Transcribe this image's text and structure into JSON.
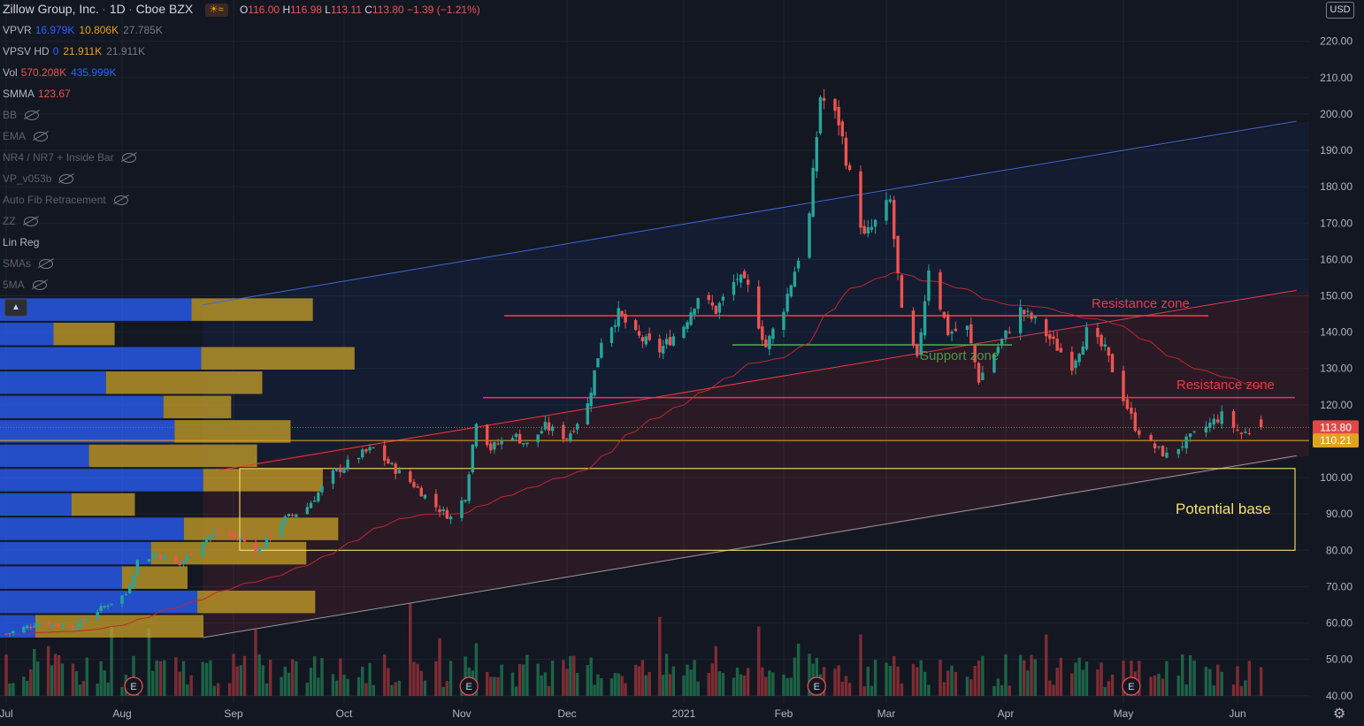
{
  "header": {
    "symbol": "Zillow Group, Inc.",
    "interval": "1D",
    "exchange": "Cboe BZX",
    "ohlc": {
      "o_label": "O",
      "o": "116.00",
      "h_label": "H",
      "h": "116.98",
      "l_label": "L",
      "l": "113.11",
      "c_label": "C",
      "c": "113.80",
      "change": "−1.39 (−1.21%)"
    }
  },
  "indicators": [
    {
      "name": "VPVR",
      "v1": "16.979K",
      "v2": "10.806K",
      "v3": "27.785K",
      "hidden": false
    },
    {
      "name": "VPSV HD",
      "v1": "0",
      "v2": "21.911K",
      "v3": "21.911K",
      "hidden": false
    },
    {
      "name": "Vol",
      "v1": "570.208K",
      "v2": "435.999K",
      "v3": "",
      "hidden": false
    },
    {
      "name": "SMMA",
      "v1": "123.67",
      "v2": "",
      "v3": "",
      "hidden": false
    },
    {
      "name": "BB",
      "hidden": true
    },
    {
      "name": "EMA",
      "hidden": true
    },
    {
      "name": "NR4 / NR7 + Inside Bar",
      "hidden": true
    },
    {
      "name": "VP_v053b",
      "hidden": true
    },
    {
      "name": "Auto Fib Retracement",
      "hidden": true
    },
    {
      "name": "ZZ",
      "hidden": true
    },
    {
      "name": "Lin Reg",
      "hidden": false
    },
    {
      "name": "SMAs",
      "hidden": true
    },
    {
      "name": "5MA",
      "hidden": true
    }
  ],
  "colors": {
    "background": "#131722",
    "up": "#26a69a",
    "down": "#ef5350",
    "volume_up": "#1e6b4a",
    "volume_down": "#8c2f35",
    "vp_blue": "#2962ff",
    "vp_gold": "#c9a227",
    "resistance": "#f23645",
    "support": "#4caf50",
    "channel_upper": "#3f6ad8",
    "channel_lower": "#9598a1",
    "smma": "#c2262e",
    "base_box": "#f5e06b",
    "price_tag": "#e1a21f",
    "last_price": "#e04848"
  },
  "controls": {
    "currency": "USD",
    "collapse_icon": "chevron-up-icon",
    "settings_icon": "gear-icon"
  },
  "annotations": {
    "resistance_1": "Resistance zone",
    "resistance_2": "Resistance zone",
    "support": "Support zone",
    "base": "Potential base"
  },
  "chart_data": {
    "type": "candlestick",
    "title": "",
    "x_ticks": [
      "Jul",
      "Aug",
      "Sep",
      "Oct",
      "Nov",
      "Dec",
      "2021",
      "Feb",
      "Mar",
      "Apr",
      "May",
      "Jun"
    ],
    "x_tick_dates": [
      "2020-07-01",
      "2020-08-03",
      "2020-09-01",
      "2020-10-01",
      "2020-11-02",
      "2020-12-01",
      "2021-01-04",
      "2021-02-01",
      "2021-03-01",
      "2021-04-01",
      "2021-05-03",
      "2021-06-01"
    ],
    "y_ticks": [
      40,
      50,
      60,
      70,
      80,
      90,
      100,
      110,
      120,
      130,
      140,
      150,
      160,
      170,
      180,
      190,
      200,
      210,
      220
    ],
    "ylim": [
      38,
      226
    ],
    "last_price": 113.8,
    "level_price": 110.21,
    "resistance_levels": [
      144.5,
      122
    ],
    "support_level": 136.5,
    "base_zone": [
      80,
      102.5
    ],
    "earnings_markers": [
      "2020-08-06",
      "2020-11-04",
      "2021-02-10",
      "2021-05-05"
    ],
    "earnings_label": "E",
    "channel_upper": [
      {
        "x": "2020-08-24",
        "y": 147.5
      },
      {
        "x": "2021-06-16",
        "y": 198
      }
    ],
    "channel_lower": [
      {
        "x": "2020-08-24",
        "y": 56
      },
      {
        "x": "2021-06-16",
        "y": 106
      }
    ],
    "red_trend": [
      {
        "x": "2020-08-28",
        "y": 102
      },
      {
        "x": "2021-06-16",
        "y": 151.5
      }
    ],
    "closes": [
      {
        "d": "2020-07-01",
        "c": 57
      },
      {
        "d": "2020-07-10",
        "c": 60
      },
      {
        "d": "2020-07-20",
        "c": 59
      },
      {
        "d": "2020-07-28",
        "c": 64
      },
      {
        "d": "2020-08-04",
        "c": 68
      },
      {
        "d": "2020-08-07",
        "c": 77
      },
      {
        "d": "2020-08-12",
        "c": 79
      },
      {
        "d": "2020-08-18",
        "c": 76
      },
      {
        "d": "2020-08-24",
        "c": 83
      },
      {
        "d": "2020-08-28",
        "c": 85
      },
      {
        "d": "2020-09-03",
        "c": 83
      },
      {
        "d": "2020-09-08",
        "c": 80
      },
      {
        "d": "2020-09-14",
        "c": 88
      },
      {
        "d": "2020-09-21",
        "c": 92
      },
      {
        "d": "2020-09-28",
        "c": 101
      },
      {
        "d": "2020-10-05",
        "c": 106
      },
      {
        "d": "2020-10-09",
        "c": 108
      },
      {
        "d": "2020-10-14",
        "c": 103
      },
      {
        "d": "2020-10-20",
        "c": 98
      },
      {
        "d": "2020-10-26",
        "c": 92
      },
      {
        "d": "2020-10-30",
        "c": 89
      },
      {
        "d": "2020-11-03",
        "c": 95
      },
      {
        "d": "2020-11-06",
        "c": 116
      },
      {
        "d": "2020-11-10",
        "c": 108
      },
      {
        "d": "2020-11-16",
        "c": 112
      },
      {
        "d": "2020-11-20",
        "c": 109
      },
      {
        "d": "2020-11-25",
        "c": 114
      },
      {
        "d": "2020-12-01",
        "c": 111
      },
      {
        "d": "2020-12-07",
        "c": 120
      },
      {
        "d": "2020-12-11",
        "c": 138
      },
      {
        "d": "2020-12-16",
        "c": 145
      },
      {
        "d": "2020-12-21",
        "c": 139
      },
      {
        "d": "2020-12-28",
        "c": 135
      },
      {
        "d": "2021-01-04",
        "c": 142
      },
      {
        "d": "2021-01-08",
        "c": 150
      },
      {
        "d": "2021-01-13",
        "c": 146
      },
      {
        "d": "2021-01-19",
        "c": 155
      },
      {
        "d": "2021-01-22",
        "c": 152
      },
      {
        "d": "2021-01-27",
        "c": 136
      },
      {
        "d": "2021-02-01",
        "c": 147
      },
      {
        "d": "2021-02-04",
        "c": 157
      },
      {
        "d": "2021-02-08",
        "c": 172
      },
      {
        "d": "2021-02-11",
        "c": 205
      },
      {
        "d": "2021-02-16",
        "c": 198
      },
      {
        "d": "2021-02-19",
        "c": 183
      },
      {
        "d": "2021-02-23",
        "c": 166
      },
      {
        "d": "2021-02-26",
        "c": 170
      },
      {
        "d": "2021-03-02",
        "c": 176
      },
      {
        "d": "2021-03-05",
        "c": 145
      },
      {
        "d": "2021-03-09",
        "c": 132
      },
      {
        "d": "2021-03-12",
        "c": 158
      },
      {
        "d": "2021-03-17",
        "c": 140
      },
      {
        "d": "2021-03-22",
        "c": 141
      },
      {
        "d": "2021-03-25",
        "c": 127
      },
      {
        "d": "2021-03-30",
        "c": 136
      },
      {
        "d": "2021-04-05",
        "c": 146
      },
      {
        "d": "2021-04-09",
        "c": 143
      },
      {
        "d": "2021-04-14",
        "c": 137
      },
      {
        "d": "2021-04-19",
        "c": 131
      },
      {
        "d": "2021-04-23",
        "c": 140
      },
      {
        "d": "2021-04-28",
        "c": 135
      },
      {
        "d": "2021-05-03",
        "c": 122
      },
      {
        "d": "2021-05-06",
        "c": 114
      },
      {
        "d": "2021-05-10",
        "c": 109
      },
      {
        "d": "2021-05-14",
        "c": 106
      },
      {
        "d": "2021-05-19",
        "c": 110
      },
      {
        "d": "2021-05-24",
        "c": 114
      },
      {
        "d": "2021-05-28",
        "c": 117
      },
      {
        "d": "2021-06-02",
        "c": 112
      },
      {
        "d": "2021-06-07",
        "c": 113.8
      }
    ]
  }
}
